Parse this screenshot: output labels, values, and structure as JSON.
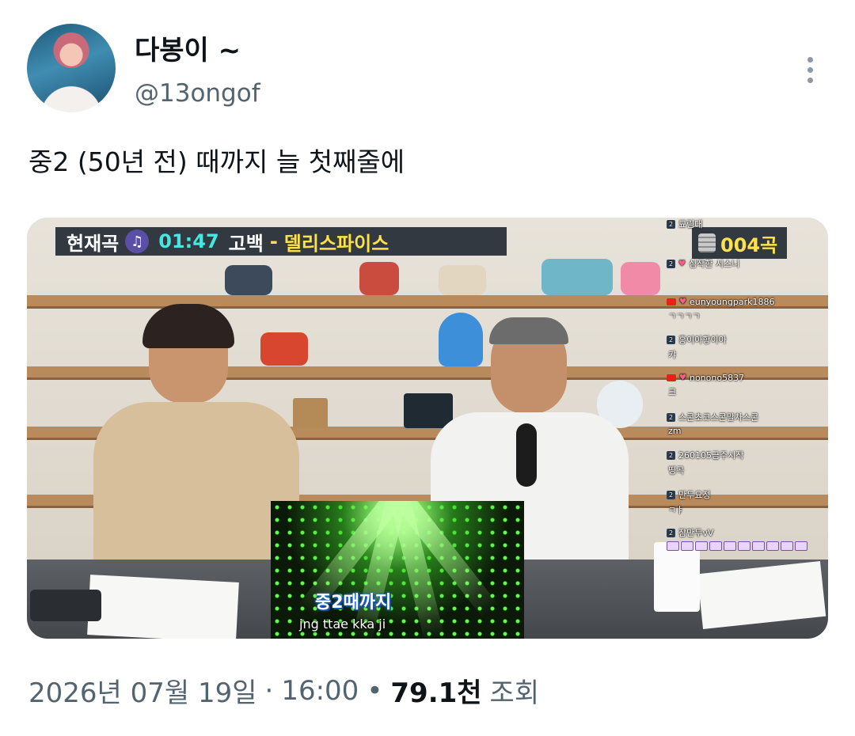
{
  "author": {
    "display_name": "다봉이 ~",
    "handle": "@13ongof",
    "avatar_icon": "profile-photo"
  },
  "tweet": {
    "text": "중2 (50년 전) 때까지 늘 첫째줄에",
    "more_icon": "more-horizontal-icon"
  },
  "media": {
    "overlay": {
      "now_playing_label": "현재곡",
      "time": "01:47",
      "song": "고백",
      "separator": "-",
      "artist": "델리스파이스",
      "song_count": "004곡"
    },
    "chat": [
      {
        "name": "묘림대",
        "msg": "",
        "platform": "chzzk"
      },
      {
        "name": "심작한 시스니",
        "msg": "",
        "platform": "chzzk"
      },
      {
        "name": "eunyoungpark1886",
        "msg": "ㄱㄱㄱㄱ",
        "platform": "youtube"
      },
      {
        "name": "홍이아항이아",
        "msg": "캬",
        "platform": "chzzk"
      },
      {
        "name": "nonono5837",
        "msg": "크",
        "platform": "youtube"
      },
      {
        "name": "스콘초코스콘말차스콘",
        "msg": "zm",
        "platform": "chzzk"
      },
      {
        "name": "260105금주시작",
        "msg": "띵곡",
        "platform": "chzzk"
      },
      {
        "name": "만두요정",
        "msg": "ㅋㅑ",
        "platform": "chzzk"
      },
      {
        "name": "잠만두vV",
        "msg": "",
        "platform": "chzzk"
      }
    ],
    "karaoke": {
      "lyric": "중2때까지",
      "romanization": "jng ttae kka ji"
    }
  },
  "meta": {
    "date": "2026년 07월 19일",
    "dot1": "·",
    "time": "16:00",
    "dot2": "•",
    "views_count": "79.1천",
    "views_label": "조회"
  },
  "colors": {
    "text_primary": "#0f1419",
    "text_secondary": "#536471",
    "overlay_time": "#48e6e3",
    "overlay_artist": "#ffe14a"
  }
}
